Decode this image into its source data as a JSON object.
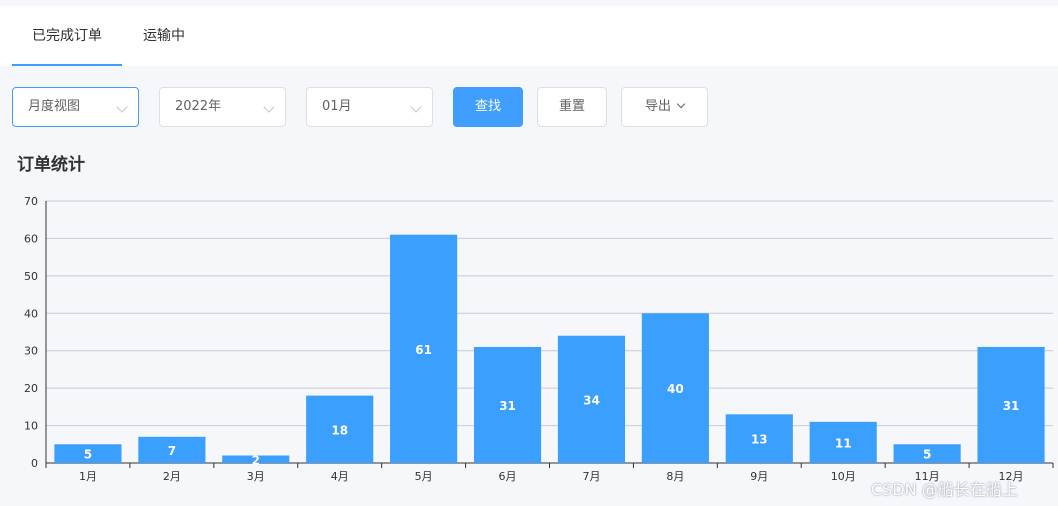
{
  "tabs": [
    {
      "label": "已完成订单",
      "active": true
    },
    {
      "label": "运输中",
      "active": false
    }
  ],
  "filters": {
    "view": "月度视图",
    "year": "2022年",
    "month": "01月",
    "search_label": "查找",
    "reset_label": "重置",
    "export_label": "导出"
  },
  "colors": {
    "accent": "#409eff",
    "bar": "#3a9ffd"
  },
  "chart_data": {
    "type": "bar",
    "title": "订单统计",
    "categories": [
      "1月",
      "2月",
      "3月",
      "4月",
      "5月",
      "6月",
      "7月",
      "8月",
      "9月",
      "10月",
      "11月",
      "12月"
    ],
    "values": [
      5,
      7,
      2,
      18,
      61,
      31,
      34,
      40,
      13,
      11,
      5,
      31
    ],
    "ylim": [
      0,
      70
    ],
    "yticks": [
      0,
      10,
      20,
      30,
      40,
      50,
      60,
      70
    ],
    "grid": true,
    "data_labels": true
  },
  "watermark": "CSDN @船长在船上"
}
